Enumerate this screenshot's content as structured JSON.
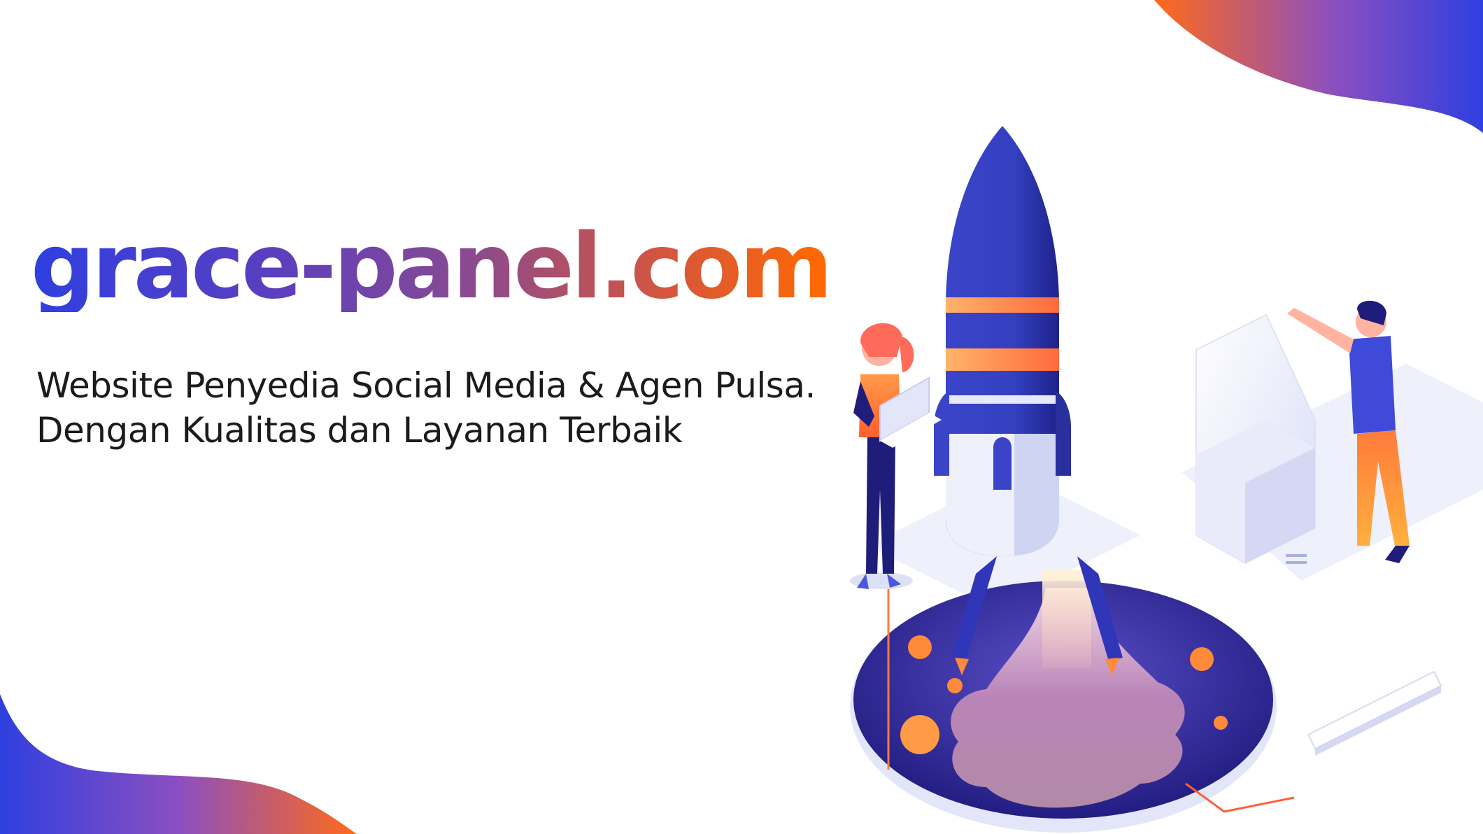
{
  "brand": {
    "name": "grace-panel.com"
  },
  "tagline": {
    "line1": "Website Penyedia Social Media & Agen Pulsa.",
    "line2": "Dengan Kualitas dan Layanan Terbaik"
  },
  "illustration": {
    "subject": "rocket-launch"
  },
  "colors": {
    "brand_blue": "#2f3fe0",
    "brand_orange": "#ff6a00",
    "dark_navy": "#1f1d7a"
  }
}
